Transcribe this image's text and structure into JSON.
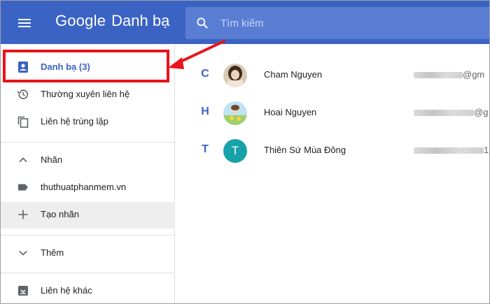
{
  "header": {
    "brand": "Google",
    "product": "Danh bạ",
    "search_placeholder": "Tìm kiếm",
    "bg_color": "#3b63c4"
  },
  "sidebar": {
    "items": [
      {
        "label": "Danh bạ (3)",
        "icon": "contacts-icon",
        "selected": true
      },
      {
        "label": "Thường xuyên liên hệ",
        "icon": "history-icon"
      },
      {
        "label": "Liên hệ trùng lặp",
        "icon": "copy-icon"
      }
    ],
    "labels_section": {
      "toggle_label": "Nhãn",
      "items": [
        {
          "label": "thuthuatphanmem.vn",
          "icon": "label-icon"
        },
        {
          "label": "Tạo nhãn",
          "icon": "plus-icon"
        }
      ]
    },
    "more_label": "Thêm",
    "other_contacts_label": "Liên hệ khác"
  },
  "contacts": [
    {
      "letter": "C",
      "name": "Cham Nguyen",
      "email_suffix": "@gm",
      "avatar": "photo"
    },
    {
      "letter": "H",
      "name": "Hoai Nguyen",
      "email_suffix": "@g",
      "avatar": "photo"
    },
    {
      "letter": "T",
      "name": "Thiên Sứ Mùa Đông",
      "email_suffix": "1",
      "avatar": "T"
    }
  ],
  "colors": {
    "accent": "#3b63c4",
    "highlight": "#e8141a",
    "avatar_teal": "#17a2a9"
  }
}
